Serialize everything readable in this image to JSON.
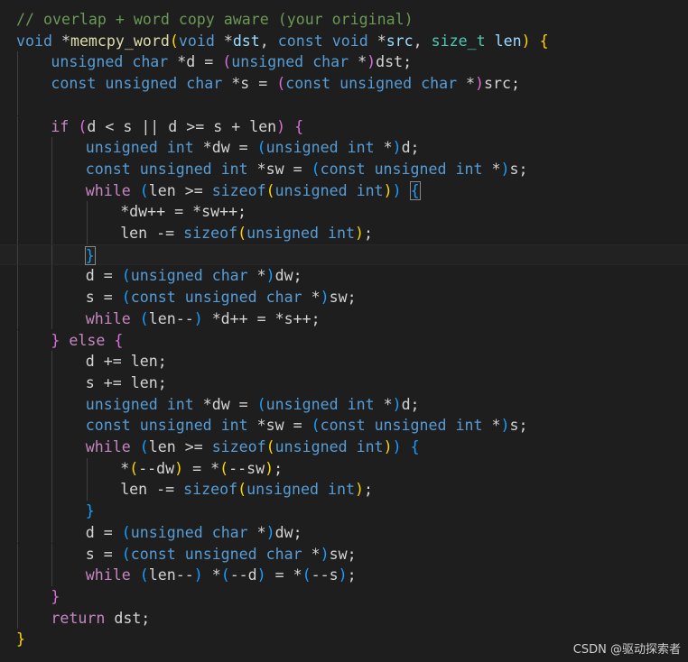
{
  "editor": {
    "lines": [
      {
        "indent": 0,
        "tokens": [
          {
            "t": "// overlap + word copy aware (your original)",
            "c": "comment"
          }
        ]
      },
      {
        "indent": 0,
        "tokens": [
          {
            "t": "void",
            "c": "kw"
          },
          {
            "t": " *",
            "c": "plain"
          },
          {
            "t": "memcpy_word",
            "c": "fn"
          },
          {
            "t": "(",
            "c": "b1"
          },
          {
            "t": "void",
            "c": "kw"
          },
          {
            "t": " *",
            "c": "plain"
          },
          {
            "t": "dst",
            "c": "var"
          },
          {
            "t": ", ",
            "c": "plain"
          },
          {
            "t": "const",
            "c": "kw"
          },
          {
            "t": " ",
            "c": "plain"
          },
          {
            "t": "void",
            "c": "kw"
          },
          {
            "t": " *",
            "c": "plain"
          },
          {
            "t": "src",
            "c": "var"
          },
          {
            "t": ", ",
            "c": "plain"
          },
          {
            "t": "size_t",
            "c": "type"
          },
          {
            "t": " ",
            "c": "plain"
          },
          {
            "t": "len",
            "c": "var"
          },
          {
            "t": ")",
            "c": "b1"
          },
          {
            "t": " ",
            "c": "plain"
          },
          {
            "t": "{",
            "c": "b1"
          }
        ]
      },
      {
        "indent": 1,
        "tokens": [
          {
            "t": "unsigned",
            "c": "kw"
          },
          {
            "t": " ",
            "c": "plain"
          },
          {
            "t": "char",
            "c": "kw"
          },
          {
            "t": " *d = ",
            "c": "plain"
          },
          {
            "t": "(",
            "c": "b2"
          },
          {
            "t": "unsigned",
            "c": "kw"
          },
          {
            "t": " ",
            "c": "plain"
          },
          {
            "t": "char",
            "c": "kw"
          },
          {
            "t": " *",
            "c": "plain"
          },
          {
            "t": ")",
            "c": "b2"
          },
          {
            "t": "dst;",
            "c": "plain"
          }
        ]
      },
      {
        "indent": 1,
        "tokens": [
          {
            "t": "const",
            "c": "kw"
          },
          {
            "t": " ",
            "c": "plain"
          },
          {
            "t": "unsigned",
            "c": "kw"
          },
          {
            "t": " ",
            "c": "plain"
          },
          {
            "t": "char",
            "c": "kw"
          },
          {
            "t": " *s = ",
            "c": "plain"
          },
          {
            "t": "(",
            "c": "b2"
          },
          {
            "t": "const",
            "c": "kw"
          },
          {
            "t": " ",
            "c": "plain"
          },
          {
            "t": "unsigned",
            "c": "kw"
          },
          {
            "t": " ",
            "c": "plain"
          },
          {
            "t": "char",
            "c": "kw"
          },
          {
            "t": " *",
            "c": "plain"
          },
          {
            "t": ")",
            "c": "b2"
          },
          {
            "t": "src;",
            "c": "plain"
          }
        ]
      },
      {
        "indent": 1,
        "tokens": []
      },
      {
        "indent": 1,
        "tokens": [
          {
            "t": "if",
            "c": "ctrl"
          },
          {
            "t": " ",
            "c": "plain"
          },
          {
            "t": "(",
            "c": "b2"
          },
          {
            "t": "d < s || d >= s + len",
            "c": "plain"
          },
          {
            "t": ")",
            "c": "b2"
          },
          {
            "t": " ",
            "c": "plain"
          },
          {
            "t": "{",
            "c": "b2"
          }
        ]
      },
      {
        "indent": 2,
        "tokens": [
          {
            "t": "unsigned",
            "c": "kw"
          },
          {
            "t": " ",
            "c": "plain"
          },
          {
            "t": "int",
            "c": "kw"
          },
          {
            "t": " *dw = ",
            "c": "plain"
          },
          {
            "t": "(",
            "c": "b3"
          },
          {
            "t": "unsigned",
            "c": "kw"
          },
          {
            "t": " ",
            "c": "plain"
          },
          {
            "t": "int",
            "c": "kw"
          },
          {
            "t": " *",
            "c": "plain"
          },
          {
            "t": ")",
            "c": "b3"
          },
          {
            "t": "d;",
            "c": "plain"
          }
        ]
      },
      {
        "indent": 2,
        "tokens": [
          {
            "t": "const",
            "c": "kw"
          },
          {
            "t": " ",
            "c": "plain"
          },
          {
            "t": "unsigned",
            "c": "kw"
          },
          {
            "t": " ",
            "c": "plain"
          },
          {
            "t": "int",
            "c": "kw"
          },
          {
            "t": " *sw = ",
            "c": "plain"
          },
          {
            "t": "(",
            "c": "b3"
          },
          {
            "t": "const",
            "c": "kw"
          },
          {
            "t": " ",
            "c": "plain"
          },
          {
            "t": "unsigned",
            "c": "kw"
          },
          {
            "t": " ",
            "c": "plain"
          },
          {
            "t": "int",
            "c": "kw"
          },
          {
            "t": " *",
            "c": "plain"
          },
          {
            "t": ")",
            "c": "b3"
          },
          {
            "t": "s;",
            "c": "plain"
          }
        ]
      },
      {
        "indent": 2,
        "tokens": [
          {
            "t": "while",
            "c": "ctrl"
          },
          {
            "t": " ",
            "c": "plain"
          },
          {
            "t": "(",
            "c": "b3"
          },
          {
            "t": "len >= ",
            "c": "plain"
          },
          {
            "t": "sizeof",
            "c": "kw"
          },
          {
            "t": "(",
            "c": "b1"
          },
          {
            "t": "unsigned",
            "c": "kw"
          },
          {
            "t": " ",
            "c": "plain"
          },
          {
            "t": "int",
            "c": "kw"
          },
          {
            "t": ")",
            "c": "b1"
          },
          {
            "t": ")",
            "c": "b3"
          },
          {
            "t": " ",
            "c": "plain"
          },
          {
            "t": "{",
            "c": "b3",
            "match": true
          }
        ]
      },
      {
        "indent": 3,
        "tokens": [
          {
            "t": "*dw++ = *sw++;",
            "c": "plain"
          }
        ]
      },
      {
        "indent": 3,
        "tokens": [
          {
            "t": "len -= ",
            "c": "plain"
          },
          {
            "t": "sizeof",
            "c": "kw"
          },
          {
            "t": "(",
            "c": "b1"
          },
          {
            "t": "unsigned",
            "c": "kw"
          },
          {
            "t": " ",
            "c": "plain"
          },
          {
            "t": "int",
            "c": "kw"
          },
          {
            "t": ")",
            "c": "b1"
          },
          {
            "t": ";",
            "c": "plain"
          }
        ]
      },
      {
        "indent": 2,
        "current": true,
        "tokens": [
          {
            "t": "}",
            "c": "b3",
            "match": true
          }
        ]
      },
      {
        "indent": 2,
        "tokens": [
          {
            "t": "d = ",
            "c": "plain"
          },
          {
            "t": "(",
            "c": "b3"
          },
          {
            "t": "unsigned",
            "c": "kw"
          },
          {
            "t": " ",
            "c": "plain"
          },
          {
            "t": "char",
            "c": "kw"
          },
          {
            "t": " *",
            "c": "plain"
          },
          {
            "t": ")",
            "c": "b3"
          },
          {
            "t": "dw;",
            "c": "plain"
          }
        ]
      },
      {
        "indent": 2,
        "tokens": [
          {
            "t": "s = ",
            "c": "plain"
          },
          {
            "t": "(",
            "c": "b3"
          },
          {
            "t": "const",
            "c": "kw"
          },
          {
            "t": " ",
            "c": "plain"
          },
          {
            "t": "unsigned",
            "c": "kw"
          },
          {
            "t": " ",
            "c": "plain"
          },
          {
            "t": "char",
            "c": "kw"
          },
          {
            "t": " *",
            "c": "plain"
          },
          {
            "t": ")",
            "c": "b3"
          },
          {
            "t": "sw;",
            "c": "plain"
          }
        ]
      },
      {
        "indent": 2,
        "tokens": [
          {
            "t": "while",
            "c": "ctrl"
          },
          {
            "t": " ",
            "c": "plain"
          },
          {
            "t": "(",
            "c": "b3"
          },
          {
            "t": "len--",
            "c": "plain"
          },
          {
            "t": ")",
            "c": "b3"
          },
          {
            "t": " *d++ = *s++;",
            "c": "plain"
          }
        ]
      },
      {
        "indent": 1,
        "tokens": [
          {
            "t": "}",
            "c": "b2"
          },
          {
            "t": " ",
            "c": "plain"
          },
          {
            "t": "else",
            "c": "ctrl"
          },
          {
            "t": " ",
            "c": "plain"
          },
          {
            "t": "{",
            "c": "b2"
          }
        ]
      },
      {
        "indent": 2,
        "tokens": [
          {
            "t": "d += len;",
            "c": "plain"
          }
        ]
      },
      {
        "indent": 2,
        "tokens": [
          {
            "t": "s += len;",
            "c": "plain"
          }
        ]
      },
      {
        "indent": 2,
        "tokens": [
          {
            "t": "unsigned",
            "c": "kw"
          },
          {
            "t": " ",
            "c": "plain"
          },
          {
            "t": "int",
            "c": "kw"
          },
          {
            "t": " *dw = ",
            "c": "plain"
          },
          {
            "t": "(",
            "c": "b3"
          },
          {
            "t": "unsigned",
            "c": "kw"
          },
          {
            "t": " ",
            "c": "plain"
          },
          {
            "t": "int",
            "c": "kw"
          },
          {
            "t": " *",
            "c": "plain"
          },
          {
            "t": ")",
            "c": "b3"
          },
          {
            "t": "d;",
            "c": "plain"
          }
        ]
      },
      {
        "indent": 2,
        "tokens": [
          {
            "t": "const",
            "c": "kw"
          },
          {
            "t": " ",
            "c": "plain"
          },
          {
            "t": "unsigned",
            "c": "kw"
          },
          {
            "t": " ",
            "c": "plain"
          },
          {
            "t": "int",
            "c": "kw"
          },
          {
            "t": " *sw = ",
            "c": "plain"
          },
          {
            "t": "(",
            "c": "b3"
          },
          {
            "t": "const",
            "c": "kw"
          },
          {
            "t": " ",
            "c": "plain"
          },
          {
            "t": "unsigned",
            "c": "kw"
          },
          {
            "t": " ",
            "c": "plain"
          },
          {
            "t": "int",
            "c": "kw"
          },
          {
            "t": " *",
            "c": "plain"
          },
          {
            "t": ")",
            "c": "b3"
          },
          {
            "t": "s;",
            "c": "plain"
          }
        ]
      },
      {
        "indent": 2,
        "tokens": [
          {
            "t": "while",
            "c": "ctrl"
          },
          {
            "t": " ",
            "c": "plain"
          },
          {
            "t": "(",
            "c": "b3"
          },
          {
            "t": "len >= ",
            "c": "plain"
          },
          {
            "t": "sizeof",
            "c": "kw"
          },
          {
            "t": "(",
            "c": "b1"
          },
          {
            "t": "unsigned",
            "c": "kw"
          },
          {
            "t": " ",
            "c": "plain"
          },
          {
            "t": "int",
            "c": "kw"
          },
          {
            "t": ")",
            "c": "b1"
          },
          {
            "t": ")",
            "c": "b3"
          },
          {
            "t": " ",
            "c": "plain"
          },
          {
            "t": "{",
            "c": "b3"
          }
        ]
      },
      {
        "indent": 3,
        "tokens": [
          {
            "t": "*",
            "c": "plain"
          },
          {
            "t": "(",
            "c": "b1"
          },
          {
            "t": "--dw",
            "c": "plain"
          },
          {
            "t": ")",
            "c": "b1"
          },
          {
            "t": " = *",
            "c": "plain"
          },
          {
            "t": "(",
            "c": "b1"
          },
          {
            "t": "--sw",
            "c": "plain"
          },
          {
            "t": ")",
            "c": "b1"
          },
          {
            "t": ";",
            "c": "plain"
          }
        ]
      },
      {
        "indent": 3,
        "tokens": [
          {
            "t": "len -= ",
            "c": "plain"
          },
          {
            "t": "sizeof",
            "c": "kw"
          },
          {
            "t": "(",
            "c": "b1"
          },
          {
            "t": "unsigned",
            "c": "kw"
          },
          {
            "t": " ",
            "c": "plain"
          },
          {
            "t": "int",
            "c": "kw"
          },
          {
            "t": ")",
            "c": "b1"
          },
          {
            "t": ";",
            "c": "plain"
          }
        ]
      },
      {
        "indent": 2,
        "tokens": [
          {
            "t": "}",
            "c": "b3"
          }
        ]
      },
      {
        "indent": 2,
        "tokens": [
          {
            "t": "d = ",
            "c": "plain"
          },
          {
            "t": "(",
            "c": "b3"
          },
          {
            "t": "unsigned",
            "c": "kw"
          },
          {
            "t": " ",
            "c": "plain"
          },
          {
            "t": "char",
            "c": "kw"
          },
          {
            "t": " *",
            "c": "plain"
          },
          {
            "t": ")",
            "c": "b3"
          },
          {
            "t": "dw;",
            "c": "plain"
          }
        ]
      },
      {
        "indent": 2,
        "tokens": [
          {
            "t": "s = ",
            "c": "plain"
          },
          {
            "t": "(",
            "c": "b3"
          },
          {
            "t": "const",
            "c": "kw"
          },
          {
            "t": " ",
            "c": "plain"
          },
          {
            "t": "unsigned",
            "c": "kw"
          },
          {
            "t": " ",
            "c": "plain"
          },
          {
            "t": "char",
            "c": "kw"
          },
          {
            "t": " *",
            "c": "plain"
          },
          {
            "t": ")",
            "c": "b3"
          },
          {
            "t": "sw;",
            "c": "plain"
          }
        ]
      },
      {
        "indent": 2,
        "tokens": [
          {
            "t": "while",
            "c": "ctrl"
          },
          {
            "t": " ",
            "c": "plain"
          },
          {
            "t": "(",
            "c": "b3"
          },
          {
            "t": "len--",
            "c": "plain"
          },
          {
            "t": ")",
            "c": "b3"
          },
          {
            "t": " *",
            "c": "plain"
          },
          {
            "t": "(",
            "c": "b3"
          },
          {
            "t": "--d",
            "c": "plain"
          },
          {
            "t": ")",
            "c": "b3"
          },
          {
            "t": " = *",
            "c": "plain"
          },
          {
            "t": "(",
            "c": "b3"
          },
          {
            "t": "--s",
            "c": "plain"
          },
          {
            "t": ")",
            "c": "b3"
          },
          {
            "t": ";",
            "c": "plain"
          }
        ]
      },
      {
        "indent": 1,
        "tokens": [
          {
            "t": "}",
            "c": "b2"
          }
        ]
      },
      {
        "indent": 1,
        "tokens": [
          {
            "t": "return",
            "c": "ctrl"
          },
          {
            "t": " dst;",
            "c": "plain"
          }
        ]
      },
      {
        "indent": 0,
        "tokens": [
          {
            "t": "}",
            "c": "b1"
          }
        ]
      }
    ]
  },
  "watermark": {
    "text": "CSDN @驱动探索者"
  },
  "colors": {
    "background": "#1e1e1e",
    "comment": "#6a9955",
    "keyword": "#569cd6",
    "control": "#c586c0",
    "function": "#dcdcaa",
    "variable": "#9cdcfe",
    "type": "#4ec9b0",
    "bracket1": "#ffd700",
    "bracket2": "#da70d6",
    "bracket3": "#179fff",
    "text": "#d4d4d4"
  }
}
